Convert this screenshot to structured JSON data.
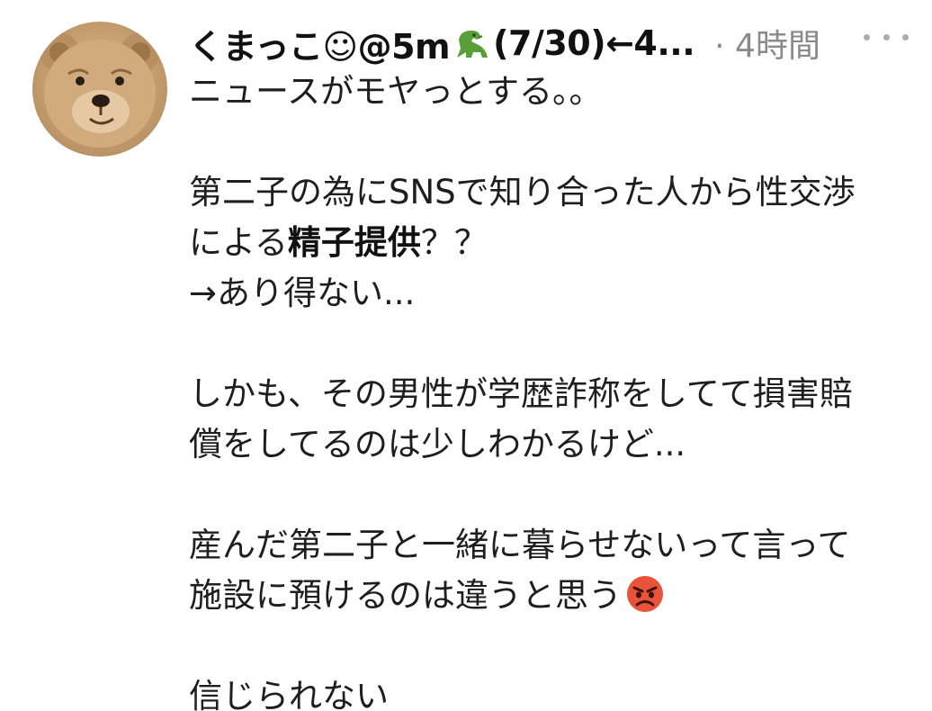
{
  "tweet": {
    "display_name": "くまっこ☺@5m",
    "name_suffix": "(7/30)←4...",
    "timestamp": "· 4時間",
    "more_label": "···",
    "lines": {
      "l1": "ニュースがモヤっとする。。",
      "l2": "第二子の為にSNSで知り合った人から性交渉",
      "l3a": "による",
      "l3b": "精子提供",
      "l3c": "？？",
      "l4": "→あり得ない...",
      "l5": "しかも、その男性が学歴詐称をしてて損害賠",
      "l6": "償をしてるのは少しわかるけど...",
      "l7": "産んだ第二子と一緒に暮らせないって言って",
      "l8": "施設に預けるのは違うと思う",
      "l9": "信じられない"
    },
    "icons": {
      "avatar": "teddy-bear-avatar",
      "name_emoji": "dinosaur-icon",
      "body_emoji": "angry-face-icon"
    },
    "colors": {
      "text": "#1e1e1e",
      "muted": "#8a8a8a",
      "more_dots": "#a8adb3",
      "angry_face": "#e8533a"
    }
  }
}
